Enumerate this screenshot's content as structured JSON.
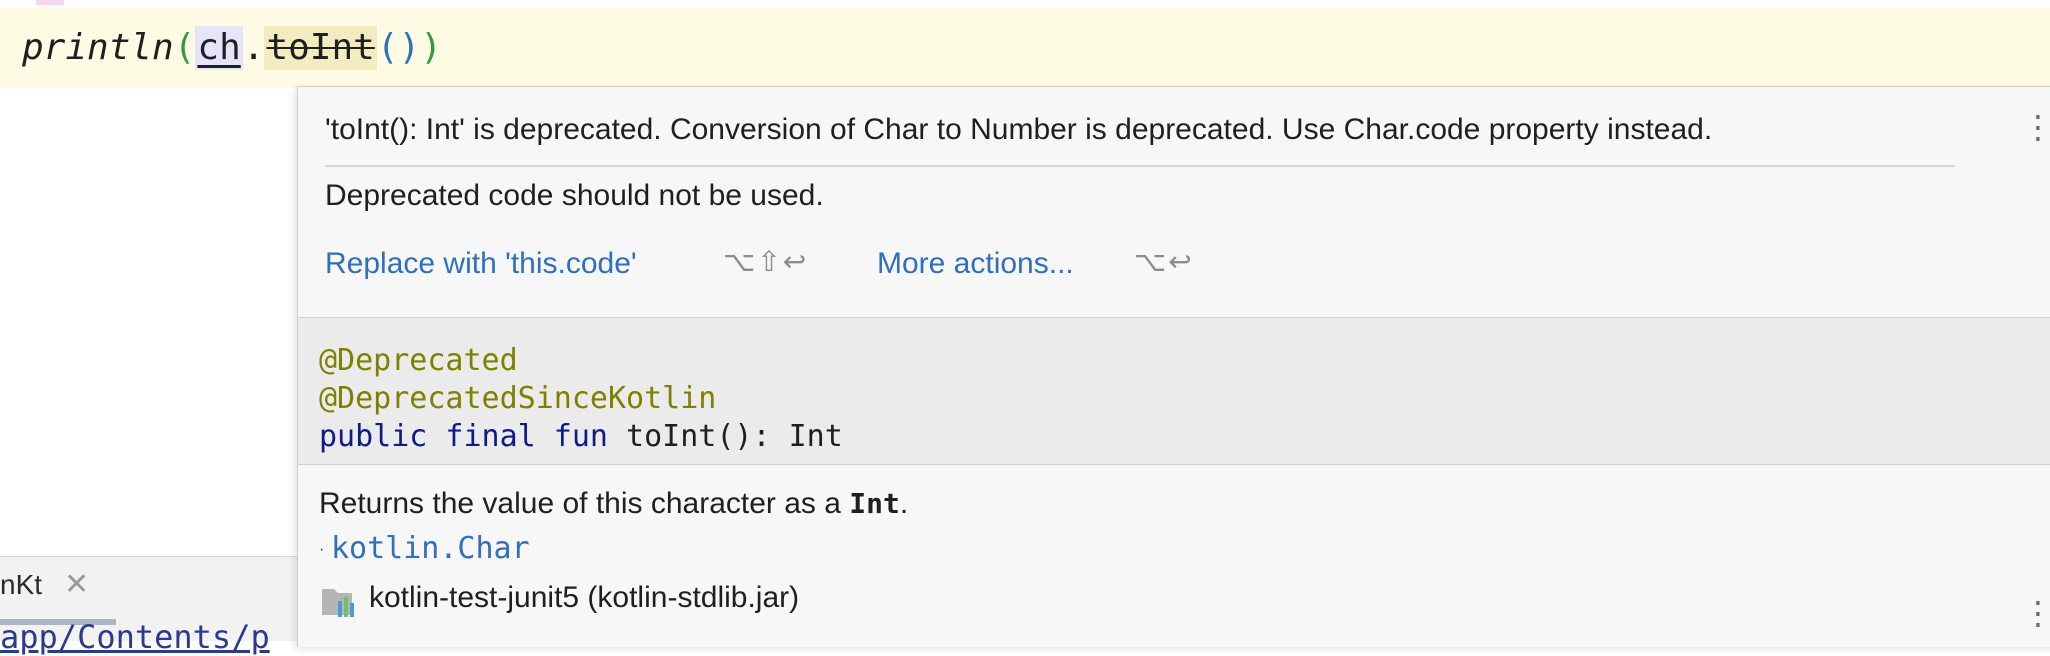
{
  "editor": {
    "code": {
      "fn_name": "println",
      "paren_open": "(",
      "ident": "ch",
      "dot": ".",
      "method": "toInt",
      "call_parens": "()",
      "paren_close": ")"
    }
  },
  "tool_window": {
    "tab_label": "nKt",
    "close_glyph": "✕",
    "path_fragment": "app/Contents/p"
  },
  "popup": {
    "problem": {
      "message": "'toInt(): Int' is deprecated. Conversion of Char to Number is deprecated. Use Char.code property instead.",
      "description": "Deprecated code should not be used.",
      "actions": [
        {
          "label": "Replace with 'this.code'",
          "shortcut": "⌥⇧↩"
        },
        {
          "label": "More actions...",
          "shortcut": "⌥↩"
        }
      ]
    },
    "signature": {
      "annotations": [
        "@Deprecated",
        "@DeprecatedSinceKotlin"
      ],
      "decl_keywords": "public final fun",
      "decl_rest": " toInt(): Int"
    },
    "doc": {
      "text_before": "Returns the value of this character as a ",
      "text_code": "Int",
      "text_after": ".",
      "owner_link": "kotlin.Char",
      "library": "kotlin-test-junit5 (kotlin-stdlib.jar)"
    },
    "menu_glyph": "⋮"
  },
  "icons": {
    "more-options": "kebab-vertical-icon",
    "library": "library-jar-icon"
  },
  "colors": {
    "link": "#2f6fbd",
    "annotation": "#808000",
    "keyword": "#0e1a8a",
    "current_line": "#fefbe5"
  }
}
